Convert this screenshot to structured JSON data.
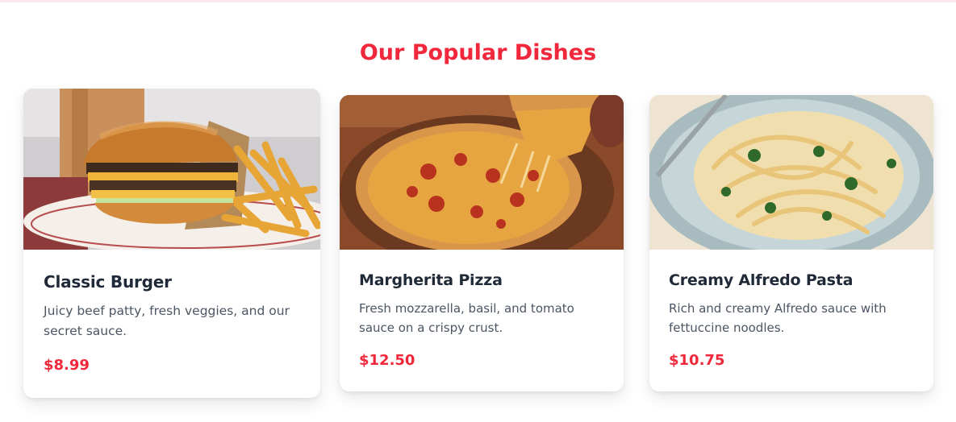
{
  "section": {
    "title": "Our Popular Dishes"
  },
  "dishes": [
    {
      "name": "Classic Burger",
      "description": "Juicy beef patty, fresh veggies, and our secret sauce.",
      "price": "$8.99",
      "image": "burger-photo"
    },
    {
      "name": "Margherita Pizza",
      "description": "Fresh mozzarella, basil, and tomato sauce on a crispy crust.",
      "price": "$12.50",
      "image": "pizza-photo"
    },
    {
      "name": "Creamy Alfredo Pasta",
      "description": "Rich and creamy Alfredo sauce with fettuccine noodles.",
      "price": "$10.75",
      "image": "pasta-photo"
    }
  ],
  "colors": {
    "accent": "#f1283b",
    "heading": "#1f2937",
    "text": "#4b5563"
  }
}
